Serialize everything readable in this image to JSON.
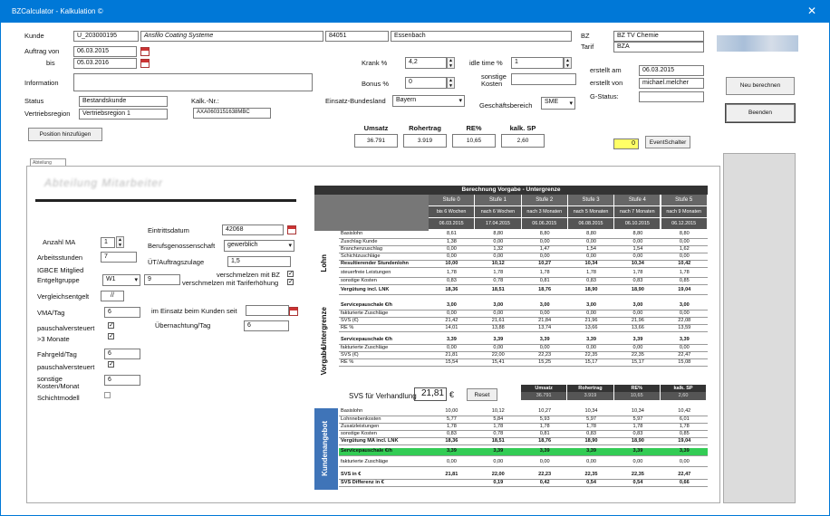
{
  "window": {
    "title": "BZCalculator - Kalkulation ©",
    "close": "✕"
  },
  "header": {
    "kunde_label": "Kunde",
    "kunde_nr": "U_203000195",
    "kunde_name": "Ansfilo Coating Systeme",
    "plz": "84051",
    "ort": "Essenbach",
    "bz_label": "BZ",
    "bz_value": "BZ TV Chemie",
    "tarif_label": "Tarif",
    "tarif_value": "BZA",
    "auftrag_von_label": "Auftrag von",
    "auftrag_von": "06.03.2015",
    "bis_label": "bis",
    "bis": "05.03.2016",
    "krank_label": "Krank %",
    "krank_value": "4,2",
    "idle_label": "idle time %",
    "idle_value": "1",
    "sonstige_kosten_label": "sonstige Kosten",
    "bonus_label": "Bonus %",
    "bonus_value": "0",
    "information_label": "Information",
    "erstellt_am_label": "erstellt am",
    "erstellt_am": "06.03.2015",
    "erstellt_von_label": "erstellt von",
    "erstellt_von": "michael.melcher",
    "gstatus_label": "G-Status:",
    "status_label": "Status",
    "status_value": "Bestandskunde",
    "kalk_nr_label": "Kalk.-Nr.:",
    "kalk_nr": "AXA0603151638MBC",
    "einsatz_bl_label": "Einsatz-Bundesland",
    "einsatz_bl": "Bayern",
    "geschaeftsbereich_label": "Geschäftsbereich",
    "geschaeftsbereich": "SME",
    "vertriebsregion_label": "Vertriebsregion",
    "vertriebsregion": "Vertriebsregion 1",
    "position_btn": "Position hinzufügen",
    "summary_headers": [
      "Umsatz",
      "Rohertrag",
      "RE%",
      "kalk. SP"
    ],
    "summary_values": [
      "36.791",
      "3.919",
      "10,65",
      "2,60"
    ],
    "event_value": "0",
    "event_btn": "EventSchalter"
  },
  "side": {
    "neu_btn": "Neu berechnen",
    "beenden_btn": "Beenden"
  },
  "tab": {
    "label": "Abteilung Mitarbeiter"
  },
  "form": {
    "blur_title": "Abteilung Mitarbeiter",
    "eintritt_label": "Eintrittsdatum",
    "eintritt_value": "42068",
    "anzahl_label": "Anzahl MA",
    "anzahl_value": "1",
    "berufsg_label": "Berufsgenossenschaft",
    "berufsg_value": "gewerblich",
    "arbeitsstunden_label": "Arbeitsstunden",
    "arbeitsstunden_value": "7",
    "ut_label": "ÜT/Auftragszulage",
    "ut_value": "1,5",
    "igbce_label": "IGBCE Mitglied",
    "entgelt_label": "Entgeltgruppe",
    "entgelt_value": "W1",
    "entgelt_num": "9",
    "verschmelzen_mit_bz": "verschmelzen mit BZ",
    "verschmelzen_tarif": "verschmelzen mit Tariferhöhung",
    "vergleichsentgelt_label": "Vergleichsentgelt",
    "vergleichsentgelt_value": "//",
    "vma_label": "VMA/Tag",
    "vma_value": "6",
    "im_einsatz_label": "im Einsatz beim Kunden seit",
    "uebernachtung_label": "Übernachtung/Tag",
    "uebernachtung_value": "6",
    "pauschal1_label": "pauschalversteuert",
    "monate_label": ">3 Monate",
    "fahrgeld_label": "Fahrgeld/Tag",
    "fahrgeld_value": "6",
    "pauschal2_label": "pauschalversteuert",
    "sonstige_label": "sonstige Kosten/Monat",
    "sonstige_value": "6",
    "schicht_label": "Schichtmodell"
  },
  "berechnung": {
    "title": "Berechnung Vorgabe - Untergrenze",
    "stufen": [
      "Stufe 0",
      "Stufe 1",
      "Stufe 2",
      "Stufe 3",
      "Stufe 4",
      "Stufe 5"
    ],
    "nach": [
      "bis 6 Wochen",
      "nach 6 Wochen",
      "nach 3 Monaten",
      "nach 5 Monaten",
      "nach 7 Monaten",
      "nach 9 Monaten"
    ],
    "dates": [
      "06.03.2015",
      "17.04.2015",
      "06.06.2015",
      "06.08.2015",
      "06.10.2015",
      "06.12.2015"
    ],
    "lohn_label": "Lohn",
    "untergrenze_label": "Untergrenze",
    "vorgabe_label": "Vorgabe",
    "rows1": [
      {
        "label": "Basislohn",
        "vals": [
          "8,61",
          "8,80",
          "8,80",
          "8,80",
          "8,80",
          "8,80"
        ]
      },
      {
        "label": "Zuschlag Kunde",
        "vals": [
          "1,38",
          "0,00",
          "0,00",
          "0,00",
          "0,00",
          "0,00"
        ]
      },
      {
        "label": "Branchenzuschlag",
        "vals": [
          "0,00",
          "1,32",
          "1,47",
          "1,54",
          "1,54",
          "1,62"
        ]
      },
      {
        "label": "Schichtzuschläge",
        "vals": [
          "0,00",
          "0,00",
          "0,00",
          "0,00",
          "0,00",
          "0,00"
        ]
      },
      {
        "label": "Resultierender Stundenlohn",
        "vals": [
          "10,00",
          "10,12",
          "10,27",
          "10,34",
          "10,34",
          "10,42"
        ]
      }
    ],
    "rows2": [
      {
        "label": "steuerfreie Leistungen",
        "vals": [
          "1,78",
          "1,78",
          "1,78",
          "1,78",
          "1,78",
          "1,78"
        ]
      },
      {
        "label": "sonstige Kosten",
        "vals": [
          "0,83",
          "0,78",
          "0,81",
          "0,83",
          "0,83",
          "0,85"
        ]
      }
    ],
    "rows3": [
      {
        "label": "Vergütung incl. LNK",
        "vals": [
          "18,36",
          "18,51",
          "18,76",
          "18,90",
          "18,90",
          "19,04"
        ]
      }
    ],
    "rows4": [
      {
        "label": "Servicepauschale €/h",
        "vals": [
          "3,00",
          "3,00",
          "3,00",
          "3,00",
          "3,00",
          "3,00"
        ]
      },
      {
        "label": "fakturierte Zuschläge",
        "vals": [
          "0,00",
          "0,00",
          "0,00",
          "0,00",
          "0,00",
          "0,00"
        ]
      },
      {
        "label": "SVS (€)",
        "vals": [
          "21,42",
          "21,61",
          "21,84",
          "21,96",
          "21,96",
          "22,08"
        ]
      },
      {
        "label": "RE %",
        "vals": [
          "14,01",
          "13,88",
          "13,74",
          "13,66",
          "13,66",
          "13,59"
        ]
      }
    ],
    "rows5": [
      {
        "label": "Servicepauschale €/h",
        "vals": [
          "3,39",
          "3,39",
          "3,39",
          "3,39",
          "3,39",
          "3,39"
        ]
      },
      {
        "label": "fakturierte Zuschläge",
        "vals": [
          "0,00",
          "0,00",
          "0,00",
          "0,00",
          "0,00",
          "0,00"
        ]
      },
      {
        "label": "SVS (€)",
        "vals": [
          "21,81",
          "22,00",
          "22,23",
          "22,35",
          "22,35",
          "22,47"
        ]
      },
      {
        "label": "RE %",
        "vals": [
          "15,54",
          "15,41",
          "15,25",
          "15,17",
          "15,17",
          "15,08"
        ]
      }
    ]
  },
  "svs": {
    "label": "SVS für Verhandlung",
    "value": "21,81",
    "currency": "€",
    "reset": "Reset",
    "headers": [
      "Umsatz",
      "Rohertrag",
      "RE%",
      "kalk. SP"
    ],
    "values": [
      "36.791",
      "3.919",
      "10,65",
      "2,60"
    ]
  },
  "kundenangebot": {
    "label": "Kundenangebot",
    "rows1": [
      {
        "label": "Basislohn",
        "vals": [
          "10,00",
          "10,12",
          "10,27",
          "10,34",
          "10,34",
          "10,42"
        ]
      },
      {
        "label": "Lohnnebenkosten",
        "vals": [
          "5,77",
          "5,84",
          "5,93",
          "5,97",
          "5,97",
          "6,01"
        ]
      },
      {
        "label": "Zusatzleistungen",
        "vals": [
          "1,78",
          "1,78",
          "1,78",
          "1,78",
          "1,78",
          "1,78"
        ]
      },
      {
        "label": "sonstige Kosten",
        "vals": [
          "0,83",
          "0,78",
          "0,81",
          "0,83",
          "0,83",
          "0,85"
        ]
      },
      {
        "label": "Vergütung MA incl. LNK",
        "vals": [
          "18,36",
          "18,51",
          "18,76",
          "18,90",
          "18,90",
          "19,04"
        ]
      }
    ],
    "service": {
      "label": "Servicepauschale €/h",
      "vals": [
        "3,39",
        "3,39",
        "3,39",
        "3,39",
        "3,39",
        "3,39"
      ]
    },
    "fakt": {
      "label": "fakturierte Zuschläge",
      "vals": [
        "0,00",
        "0,00",
        "0,00",
        "0,00",
        "0,00",
        "0,00"
      ]
    },
    "rows2": [
      {
        "label": "SVS in €",
        "vals": [
          "21,81",
          "22,00",
          "22,23",
          "22,35",
          "22,35",
          "22,47"
        ]
      },
      {
        "label": "SVS Differenz in €",
        "vals": [
          "",
          "0,19",
          "0,42",
          "0,54",
          "0,54",
          "0,66"
        ]
      }
    ]
  },
  "colors": {
    "titlebar": "#0078d7",
    "header_dark": "#333333",
    "stufe_gray": "#666666",
    "service_green": "#33cc55",
    "kunden_blue": "#3f74b8",
    "event_yellow": "#ffff66"
  }
}
